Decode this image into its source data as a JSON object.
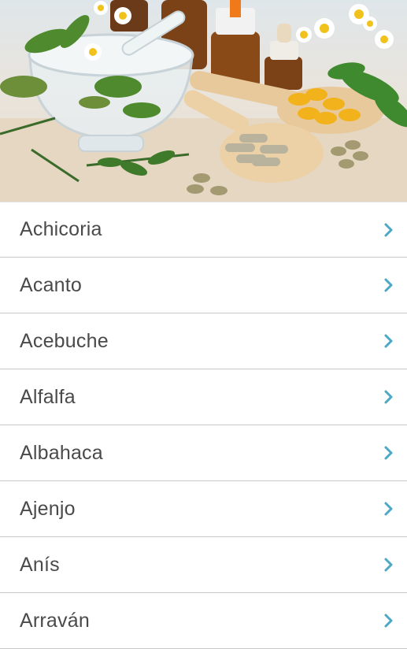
{
  "hero": {
    "image": "herbal-medicine-photo",
    "description_icon": "herbs-mortar-capsules-image"
  },
  "plants": {
    "items": [
      {
        "label": "Achicoria"
      },
      {
        "label": "Acanto"
      },
      {
        "label": "Acebuche"
      },
      {
        "label": "Alfalfa"
      },
      {
        "label": "Albahaca"
      },
      {
        "label": "Ajenjo"
      },
      {
        "label": "Anís"
      },
      {
        "label": "Arraván"
      }
    ],
    "chevron_icon": "chevron-right-icon"
  },
  "colors": {
    "chevron": "#4aa9c6",
    "divider": "#c9c9c9",
    "text": "#4a4a4a"
  }
}
